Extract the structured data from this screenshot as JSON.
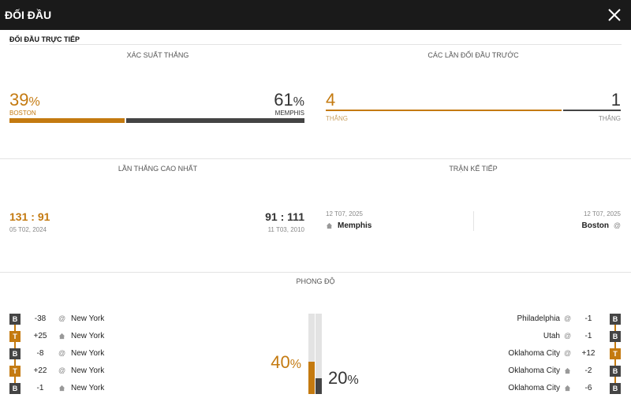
{
  "header": {
    "title": "ĐỐI ĐẦU"
  },
  "subtitle": "ĐỐI ĐẦU TRỰC TIẾP",
  "win_prob": {
    "label": "XÁC SUẤT THẮNG",
    "left_value": "39",
    "left_team": "BOSTON",
    "right_value": "61",
    "right_team": "MEMPHIS",
    "pct_sign": "%",
    "left_fraction": 0.39
  },
  "previous": {
    "label": "CÁC LẦN ĐỐI ĐẦU TRƯỚC",
    "left_value": "4",
    "left_sub": "THẮNG",
    "right_value": "1",
    "right_sub": "THẮNG",
    "left_fraction": 0.8
  },
  "biggest_win": {
    "label": "LẦN THẮNG CAO NHẤT",
    "left_score_a": "131",
    "left_score_b": "91",
    "left_date": "05 T02, 2024",
    "right_score_a": "91",
    "right_score_b": "111",
    "right_date": "11 T03, 2010",
    "sep": ":"
  },
  "next_match": {
    "label": "TRẬN KẾ TIẾP",
    "left_date": "12 T07, 2025",
    "left_team": "Memphis",
    "right_date": "12 T07, 2025",
    "right_team": "Boston"
  },
  "form": {
    "label": "PHONG ĐỘ",
    "left_pct": "40",
    "right_pct": "20",
    "pct_sign": "%",
    "left_fraction": 0.4,
    "right_fraction": 0.2,
    "left_rows": [
      {
        "result": "B",
        "diff": "-38",
        "venue": "@",
        "team": "New York"
      },
      {
        "result": "T",
        "diff": "+25",
        "venue": "home",
        "team": "New York"
      },
      {
        "result": "B",
        "diff": "-8",
        "venue": "@",
        "team": "New York"
      },
      {
        "result": "T",
        "diff": "+22",
        "venue": "@",
        "team": "New York"
      },
      {
        "result": "B",
        "diff": "-1",
        "venue": "home",
        "team": "New York"
      }
    ],
    "right_rows": [
      {
        "result": "B",
        "diff": "-1",
        "venue": "@",
        "team": "Philadelphia"
      },
      {
        "result": "B",
        "diff": "-1",
        "venue": "@",
        "team": "Utah"
      },
      {
        "result": "T",
        "diff": "+12",
        "venue": "@",
        "team": "Oklahoma City"
      },
      {
        "result": "B",
        "diff": "-2",
        "venue": "home",
        "team": "Oklahoma City"
      },
      {
        "result": "B",
        "diff": "-6",
        "venue": "home",
        "team": "Oklahoma City"
      }
    ]
  },
  "colors": {
    "accent": "#c47a10",
    "dark": "#444444",
    "track": "#e3e3e3"
  },
  "icons": {
    "close": "close-icon",
    "home": "home-icon",
    "away": "at-icon"
  }
}
